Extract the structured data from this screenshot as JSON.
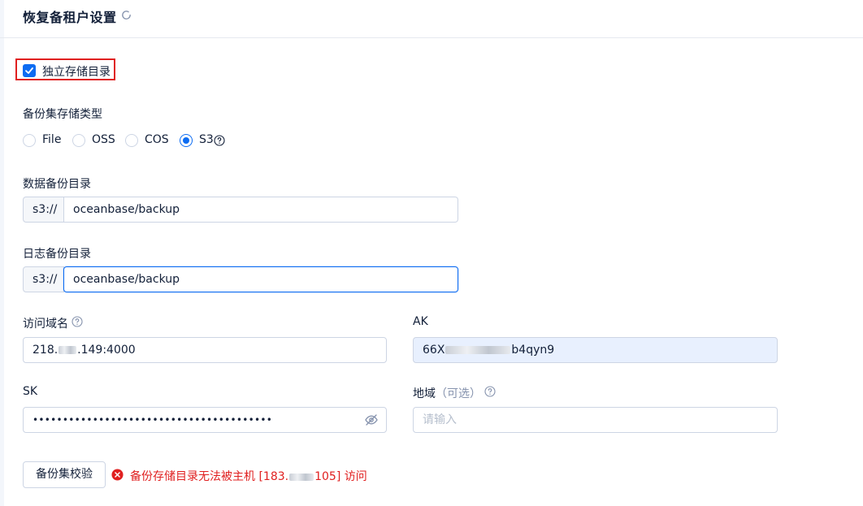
{
  "header": {
    "title": "恢复备租户设置",
    "refresh_icon": "refresh-icon"
  },
  "independent_dir": {
    "label": "独立存储目录",
    "checked": true
  },
  "storage_type": {
    "label": "备份集存储类型",
    "options": [
      "File",
      "OSS",
      "COS",
      "S3"
    ],
    "selected": "S3"
  },
  "data_backup": {
    "label": "数据备份目录",
    "prefix": "s3://",
    "value": "oceanbase/backup"
  },
  "log_backup": {
    "label": "日志备份目录",
    "prefix": "s3://",
    "value": "oceanbase/backup"
  },
  "endpoint": {
    "label": "访问域名",
    "value_start": "218.",
    "value_end": ".149:4000"
  },
  "ak": {
    "label": "AK",
    "value_start": "66X",
    "value_end": "b4qyn9"
  },
  "sk": {
    "label": "SK",
    "value": "••••••••••••••••••••••••••••••••••••••••"
  },
  "region": {
    "label": "地域",
    "optional": "（可选）",
    "placeholder": "请输入"
  },
  "check_button": {
    "label": "备份集校验"
  },
  "error": {
    "text_start": "备份存储目录无法被主机 [183.",
    "text_end": "105] 访问"
  },
  "colors": {
    "primary": "#0d6cf2",
    "error": "#e02020",
    "highlight_border": "#e02020",
    "autofill_bg": "#e8f0fe"
  }
}
